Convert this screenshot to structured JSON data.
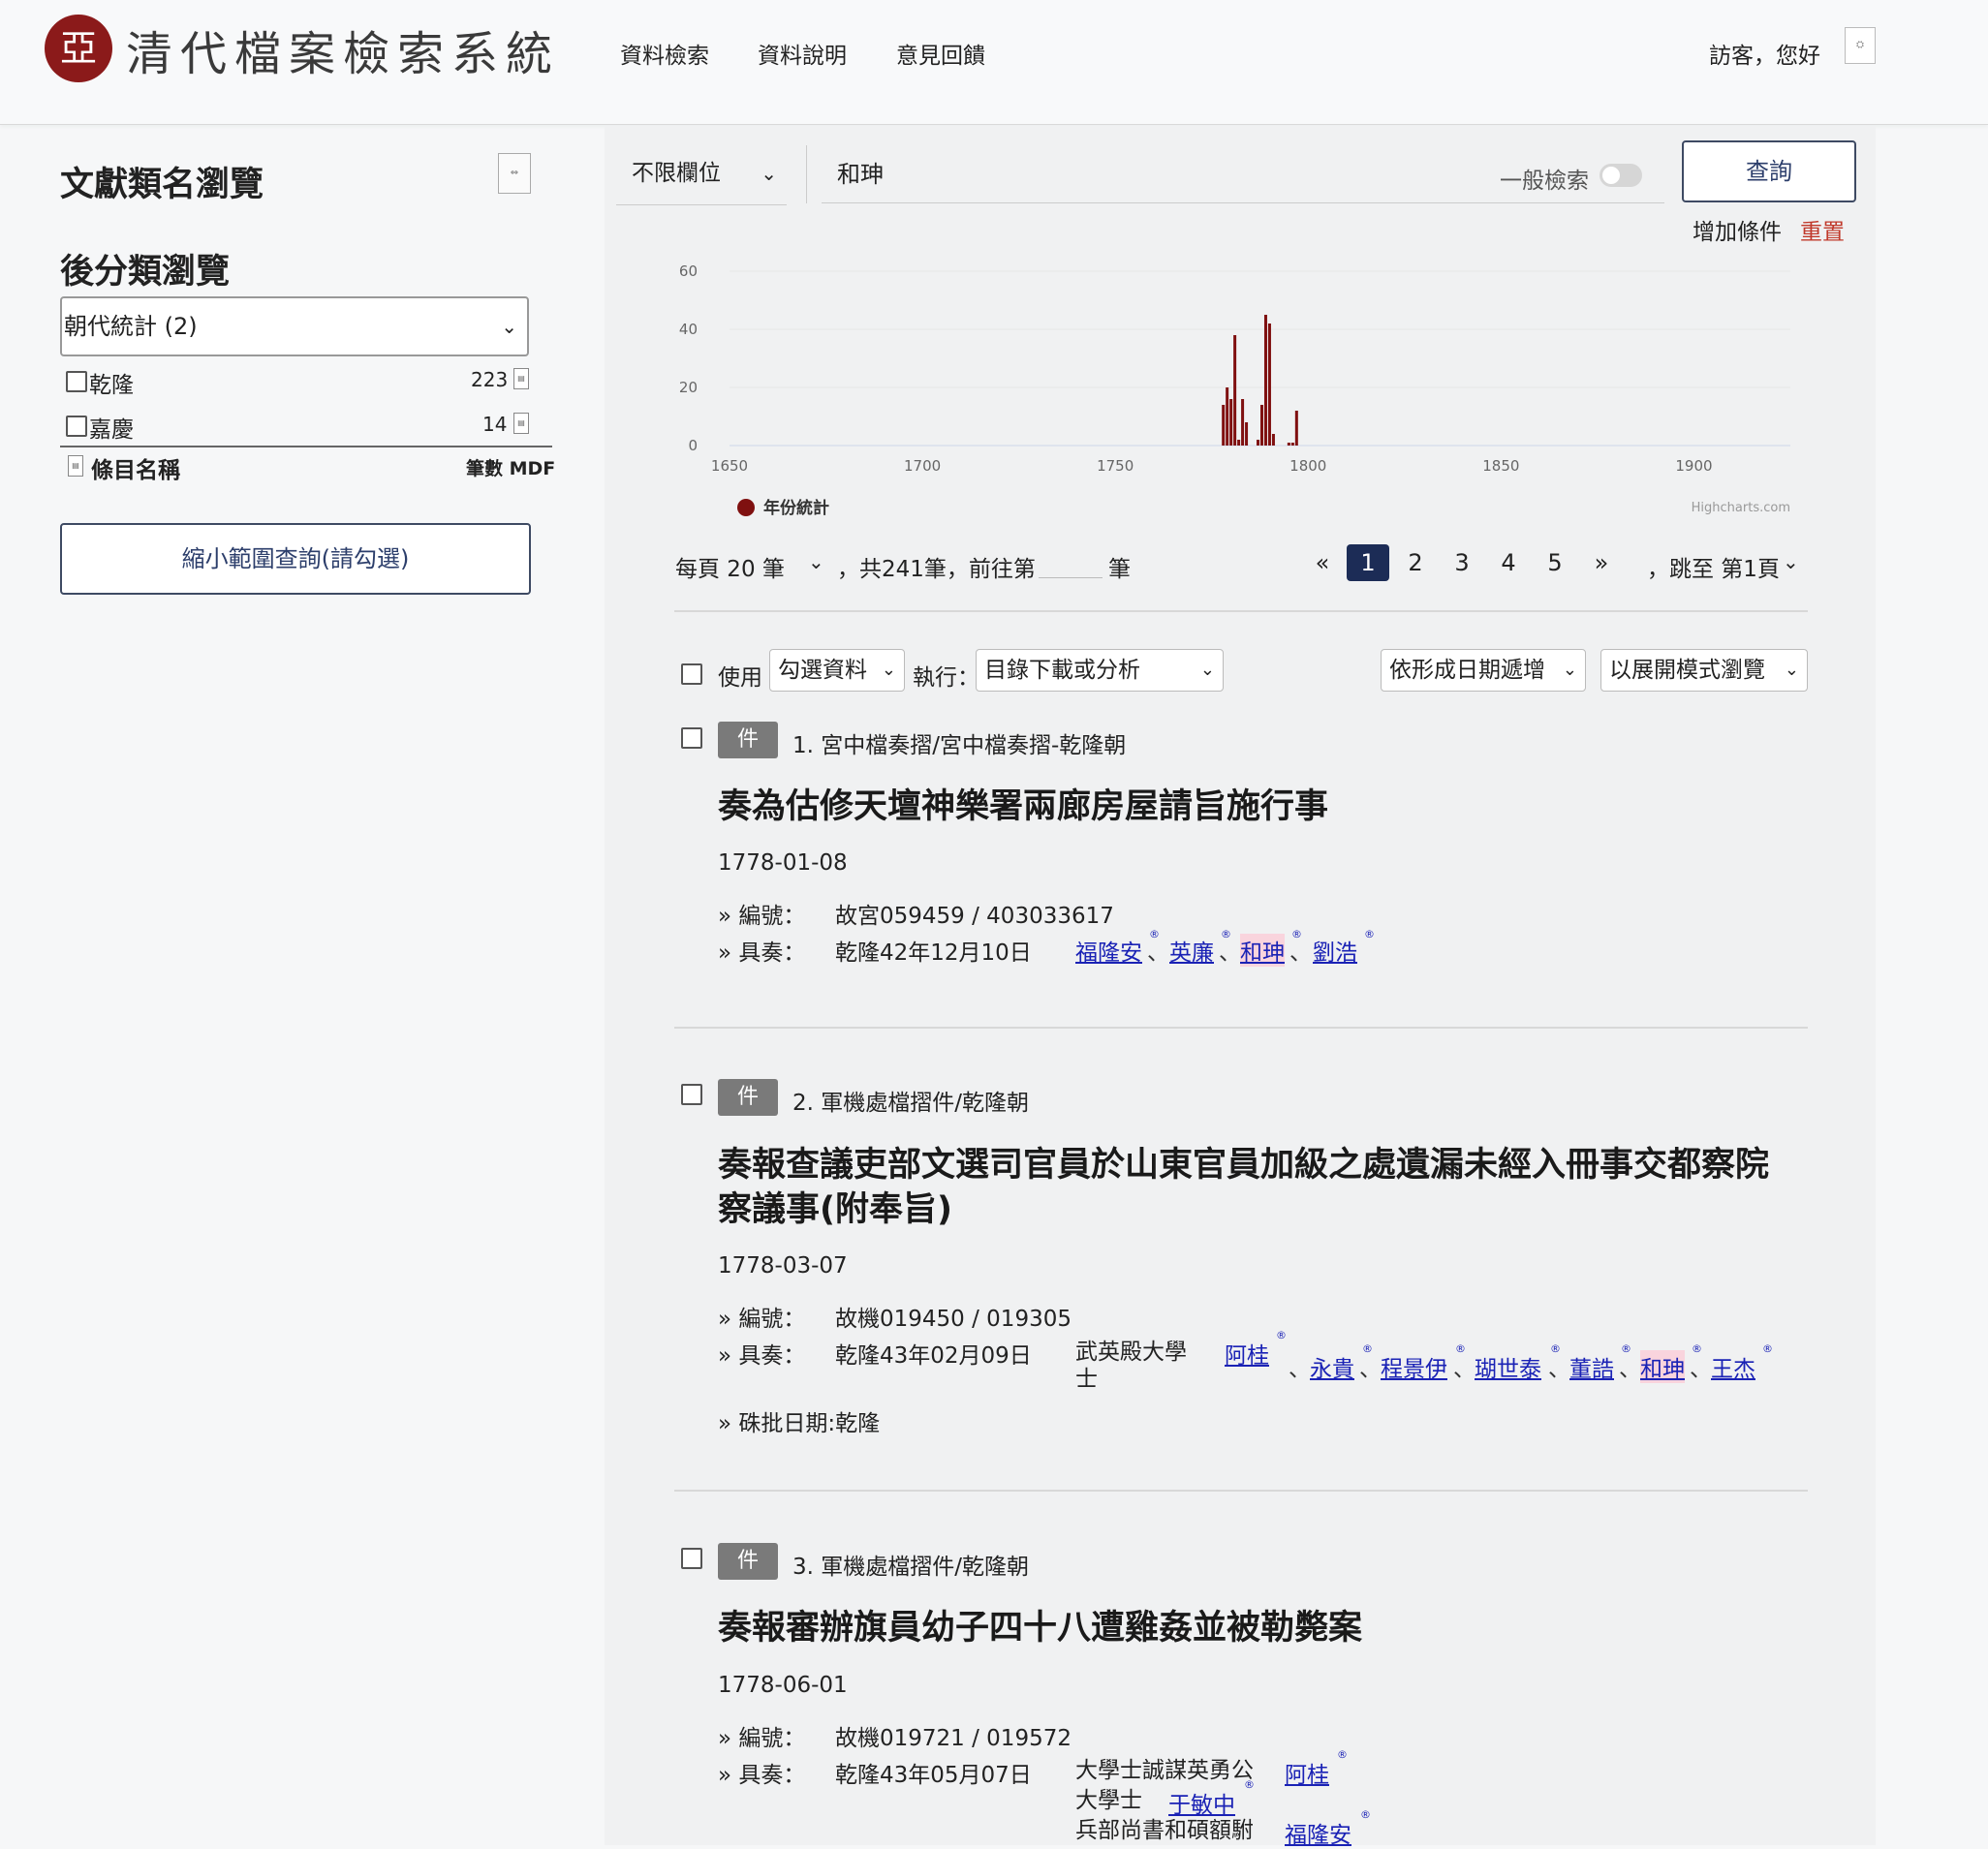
{
  "header": {
    "logo_glyph": "亞",
    "site_title": "清代檔案檢索系統",
    "nav": [
      "資料檢索",
      "資料說明",
      "意見回饋"
    ],
    "greeting": "訪客，您好"
  },
  "sidebar": {
    "title": "文獻類名瀏覽",
    "subtitle": "後分類瀏覽",
    "select_value": "朝代統計 (2)",
    "filters": [
      {
        "label": "乾隆",
        "count": "223"
      },
      {
        "label": "嘉慶",
        "count": "14"
      }
    ],
    "col_name": "條目名稱",
    "col_count": "筆數 MDF",
    "narrow_button": "縮小範圍查詢(請勾選)"
  },
  "search": {
    "field": "不限欄位",
    "query": "和珅",
    "mode_label": "一般檢索",
    "query_button": "查詢",
    "add_condition": "增加條件",
    "reset": "重置"
  },
  "chart_data": {
    "type": "bar",
    "x_ticks": [
      "1650",
      "1700",
      "1750",
      "1800",
      "1850",
      "1900"
    ],
    "y_ticks": [
      "0",
      "20",
      "40",
      "60"
    ],
    "xlim": [
      1650,
      1925
    ],
    "ylim": [
      0,
      60
    ],
    "series": [
      {
        "name": "年份統計",
        "x": [
          1778,
          1779,
          1780,
          1781,
          1782,
          1783,
          1784,
          1787,
          1788,
          1789,
          1790,
          1791,
          1795,
          1796,
          1797
        ],
        "values": [
          14,
          20,
          16,
          38,
          2,
          16,
          8,
          2,
          14,
          45,
          42,
          4,
          1,
          1,
          12
        ]
      }
    ],
    "colors": {
      "bar": "#7f1010",
      "grid": "#e6e6e6",
      "axis": "#ccd6eb"
    },
    "credit": "Highcharts.com"
  },
  "pagination": {
    "per_page": "每頁 20 筆",
    "total": "，共241筆，前往第",
    "goto_unit": "筆",
    "prev": "«",
    "pages": [
      "1",
      "2",
      "3",
      "4",
      "5"
    ],
    "next": "»",
    "jump": "，跳至 第1頁"
  },
  "toolbar": {
    "use": "使用",
    "use_select": "勾選資料",
    "exec": "執行：",
    "exec_select": "目錄下載或分析",
    "sort_select": "依形成日期遞增",
    "view_select": "以展開模式瀏覽"
  },
  "labels": {
    "badge": "件",
    "number_label": "» 編號：",
    "jz_label": "» 具奏：",
    "zhupi_label": "» 硃批日期:乾隆",
    "reg": "®",
    "sep": "、"
  },
  "results": [
    {
      "category": "1.  宮中檔奏摺/宮中檔奏摺-乾隆朝",
      "title_lines": [
        "奏為估修天壇神樂署兩廊房屋請旨施行事"
      ],
      "date": "1778-01-08",
      "number": "故宮059459  /  403033617",
      "jz_date": "乾隆42年12月10日",
      "persons": [
        "福隆安",
        "英廉",
        "和珅",
        "劉浩"
      ]
    },
    {
      "category": "2.  軍機處檔摺件/乾隆朝",
      "title_lines": [
        "奏報查議吏部文選司官員於山東官員加級之處遺漏未經入冊事交都察院",
        "察議事(附奉旨)"
      ],
      "date": "1778-03-07",
      "number": "故機019450  /  019305",
      "jz_date": "乾隆43年02月09日",
      "office_lines": [
        "武英殿大學",
        "士"
      ],
      "persons": [
        "阿桂",
        "永貴",
        "程景伊",
        "瑚世泰",
        "董誥",
        "和珅",
        "王杰"
      ]
    },
    {
      "category": "3.  軍機處檔摺件/乾隆朝",
      "title_lines": [
        "奏報審辦旗員幼子四十八遭雞姦並被勒斃案"
      ],
      "date": "1778-06-01",
      "number": "故機019721  /  019572",
      "jz_date": "乾隆43年05月07日",
      "office_lines": [
        "大學士誠謀英勇公",
        "大學士",
        "兵部尚書和碩額駙"
      ],
      "persons": [
        "阿桂",
        "于敏中",
        "福隆安"
      ]
    }
  ]
}
